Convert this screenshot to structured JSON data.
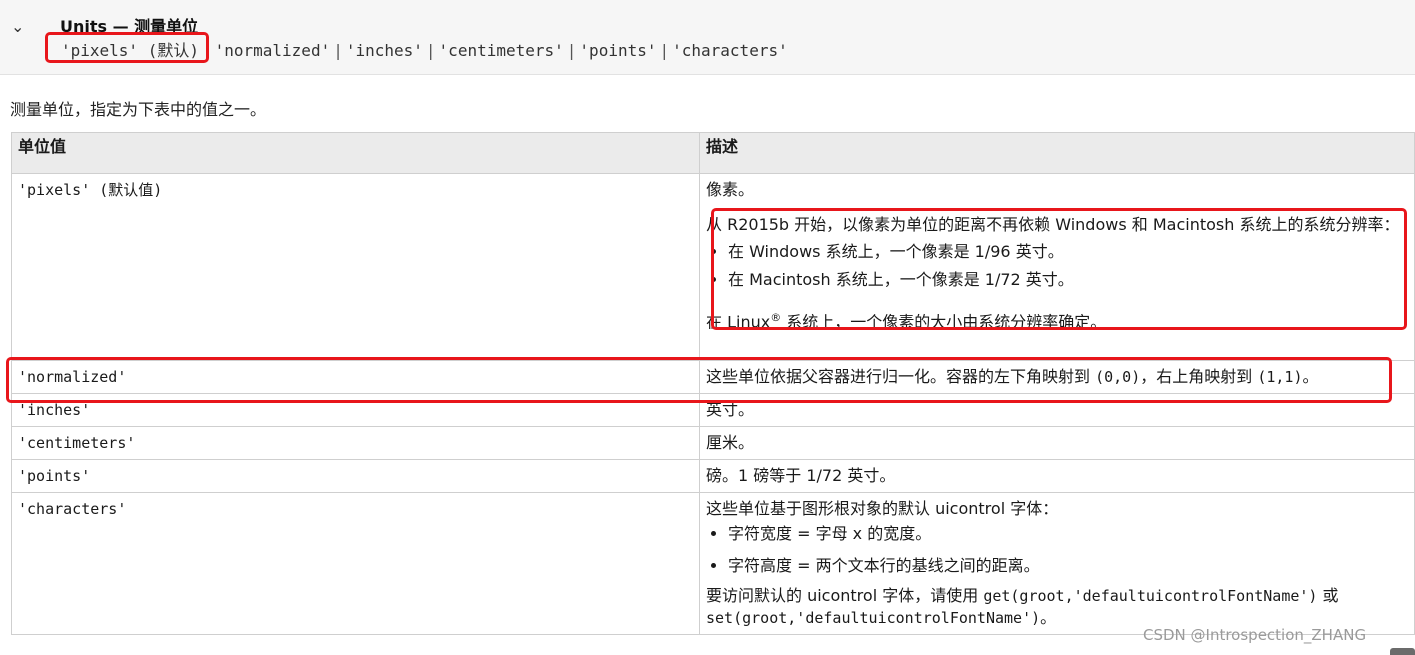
{
  "header": {
    "title": "Units — 测量单位",
    "values": [
      "'pixels' (默认)",
      "'normalized'",
      "'inches'",
      "'centimeters'",
      "'points'",
      "'characters'"
    ],
    "separator": "|"
  },
  "intro": "测量单位，指定为下表中的值之一。",
  "table": {
    "headers": [
      "单位值",
      "描述"
    ],
    "pixels": {
      "unit": "'pixels' (默认值)",
      "desc1": "像素。",
      "desc2": "从 R2015b 开始，以像素为单位的距离不再依赖 Windows 和 Macintosh 系统上的系统分辨率：",
      "bullets": [
        "在 Windows 系统上，一个像素是 1/96 英寸。",
        "在 Macintosh 系统上，一个像素是 1/72 英寸。"
      ],
      "linux_pre": "在 Linux",
      "linux_sup": "®",
      "linux_post": " 系统上，一个像素的大小由系统分辨率确定。"
    },
    "normalized": {
      "unit": "'normalized'",
      "desc_a": "这些单位依据父容器进行归一化。容器的左下角映射到 ",
      "code_a": "(0,0)",
      "desc_b": "，右上角映射到 ",
      "code_b": "(1,1)",
      "desc_c": "。"
    },
    "inches": {
      "unit": "'inches'",
      "desc": "英寸。"
    },
    "centimeters": {
      "unit": "'centimeters'",
      "desc": "厘米。"
    },
    "points": {
      "unit": "'points'",
      "desc": "磅。1 磅等于 1/72 英寸。"
    },
    "characters": {
      "unit": "'characters'",
      "desc1": "这些单位基于图形根对象的默认 uicontrol 字体：",
      "bullets": [
        "字符宽度 = 字母 x 的宽度。",
        "字符高度 = 两个文本行的基线之间的距离。"
      ],
      "desc2_a": "要访问默认的 uicontrol 字体，请使用 ",
      "code_a": "get(groot,'defaultuicontrolFontName')",
      "desc2_b": " 或 ",
      "code_b": "set(groot,'defaultuicontrolFontName')",
      "desc2_c": "。"
    }
  },
  "watermark": "CSDN @Introspection_ZHANG",
  "colors": {
    "highlight": "#e8161b",
    "header_bg": "#f6f6f6",
    "th_bg": "#ebebeb"
  }
}
